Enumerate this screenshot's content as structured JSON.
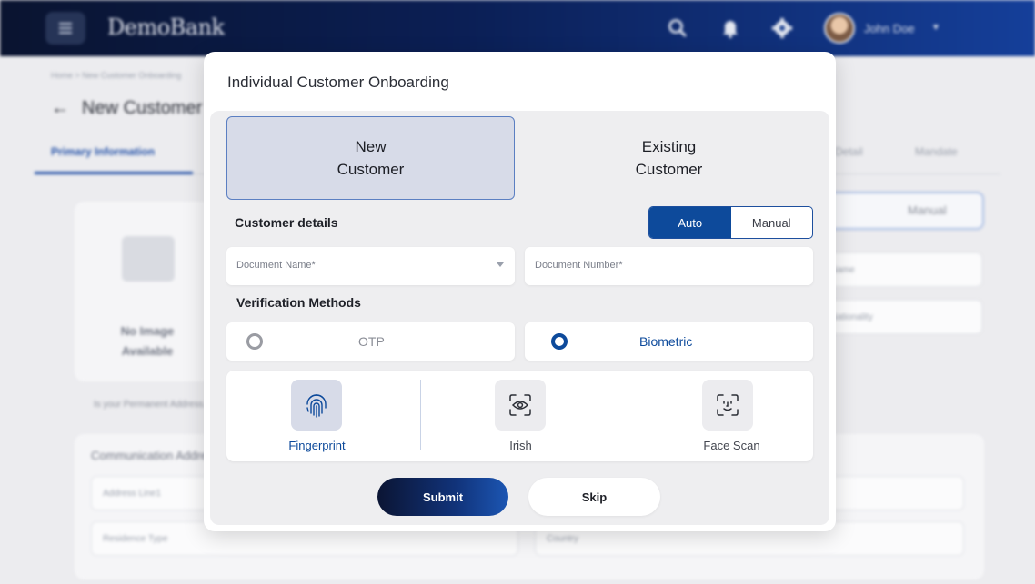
{
  "background": {
    "brand": "DemoBank",
    "user_name": "John Doe",
    "breadcrumb": "Home > New Customer Onboarding",
    "page_title": "New Customer",
    "tabs": [
      "Primary Information",
      "Detail",
      "Mandate"
    ],
    "no_image_text": "No Image Available",
    "permanent_address_question": "Is your Permanent Address...",
    "communication_title": "Communication Address",
    "fields": [
      "Address Line1",
      "Residence Type",
      "Country",
      "Name",
      "Nationality"
    ],
    "segment": [
      "Auto",
      "Manual"
    ]
  },
  "modal": {
    "title": "Individual Customer Onboarding",
    "customer_types": {
      "new": {
        "line1": "New",
        "line2": "Customer"
      },
      "existing": {
        "line1": "Existing",
        "line2": "Customer"
      }
    },
    "customer_details_label": "Customer details",
    "mode_toggle": {
      "auto": "Auto",
      "manual": "Manual"
    },
    "document_name_placeholder": "Document Name*",
    "document_number_placeholder": "Document Number*",
    "verification_label": "Verification Methods",
    "verification_options": {
      "otp": "OTP",
      "biometric": "Biometric"
    },
    "biometric_options": {
      "fingerprint": "Fingerprint",
      "iris": "Irish",
      "face": "Face Scan"
    },
    "submit_label": "Submit",
    "skip_label": "Skip"
  },
  "colors": {
    "primary": "#0d4a9b",
    "selected_bg": "#d7dbe8",
    "topbar_dark": "#0a1430"
  },
  "icons": [
    "menu-icon",
    "search-icon",
    "bell-icon",
    "settings-icon",
    "fingerprint-icon",
    "iris-scan-icon",
    "face-scan-icon",
    "dropdown-caret-icon"
  ]
}
